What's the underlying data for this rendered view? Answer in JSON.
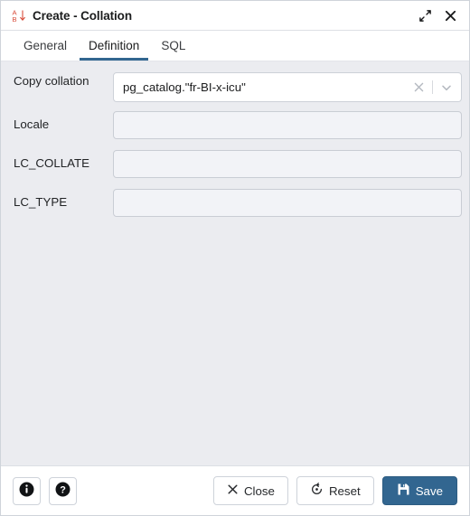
{
  "window": {
    "title": "Create - Collation",
    "icon": "collation-icon",
    "icon_color": "#d84a38",
    "controls": [
      {
        "name": "expand-icon",
        "label": "Expand"
      },
      {
        "name": "close-icon",
        "label": "Close"
      }
    ]
  },
  "tabs": [
    {
      "label": "General",
      "active": false,
      "name": "tab-general"
    },
    {
      "label": "Definition",
      "active": true,
      "name": "tab-definition"
    },
    {
      "label": "SQL",
      "active": false,
      "name": "tab-sql"
    }
  ],
  "form": {
    "copy_collation": {
      "label": "Copy collation",
      "value": "pg_catalog.\"fr-BI-x-icu\"",
      "clear_icon": "clear-icon",
      "dropdown_icon": "chevron-down-icon"
    },
    "locale": {
      "label": "Locale",
      "value": "",
      "placeholder": ""
    },
    "lc_collate": {
      "label": "LC_COLLATE",
      "value": "",
      "placeholder": ""
    },
    "lc_type": {
      "label": "LC_TYPE",
      "value": "",
      "placeholder": ""
    }
  },
  "footer": {
    "info_button": {
      "label": "Info",
      "icon": "info-icon"
    },
    "help_button": {
      "label": "Help",
      "icon": "help-icon"
    },
    "close_button": {
      "label": "Close",
      "icon": "close-x-icon"
    },
    "reset_button": {
      "label": "Reset",
      "icon": "reset-icon"
    },
    "save_button": {
      "label": "Save",
      "icon": "save-disk-icon"
    }
  },
  "theme": {
    "accent": "#326690",
    "body_background": "#ebecf0",
    "panel_background": "#ffffff",
    "icon_red": "#d84a38"
  }
}
